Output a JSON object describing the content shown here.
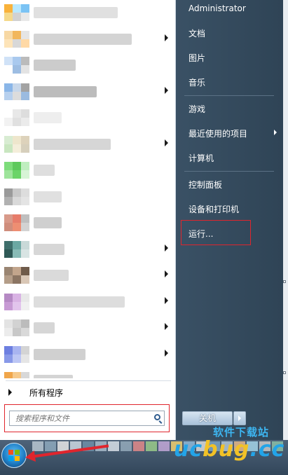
{
  "left_panel": {
    "rows": [
      {
        "icon_colors": [
          "#f9b23b",
          "#b8e8ff",
          "#7bc3f4",
          "#f5d98a",
          "#d1d1d1",
          "#e8e8e8"
        ],
        "label_color": "#e0e0e0",
        "label_width": 120,
        "has_submenu": false
      },
      {
        "icon_colors": [
          "#f7d8a4",
          "#f2b75c",
          "#e5e5e5",
          "#fde4b9",
          "#d8d8d8",
          "#ffd9a6"
        ],
        "label_color": "#d4d4d4",
        "label_width": 140,
        "has_submenu": true
      },
      {
        "icon_colors": [
          "#d0e2f7",
          "#a9c9ee",
          "#bbbbbb",
          "#ffffff",
          "#9dbde2",
          "#e3e3e3"
        ],
        "label_color": "#cccccc",
        "label_width": 60,
        "has_submenu": false
      },
      {
        "icon_colors": [
          "#8ab6e8",
          "#c7d7ea",
          "#a3a3a3",
          "#b7d0ee",
          "#dcdcdc",
          "#9bbbe0"
        ],
        "label_color": "#bcbcbc",
        "label_width": 90,
        "has_submenu": true
      },
      {
        "icon_colors": [
          "#ffffff",
          "#e8e8e8",
          "#dddddd",
          "#f2f2f2",
          "#e0e0e0",
          "#ebebeb"
        ],
        "label_color": "#eeeeee",
        "label_width": 40,
        "has_submenu": false
      },
      {
        "icon_colors": [
          "#d8ecd2",
          "#eee6cc",
          "#ddd2bb",
          "#c9e6c0",
          "#f4eeda",
          "#d6cfbc"
        ],
        "label_color": "#d6d6d6",
        "label_width": 110,
        "has_submenu": true
      },
      {
        "icon_colors": [
          "#7ddc7a",
          "#5ec95c",
          "#bfeebf",
          "#9ee49b",
          "#6bd468",
          "#d7f4d6"
        ],
        "label_color": "#dedede",
        "label_width": 30,
        "has_submenu": false
      },
      {
        "icon_colors": [
          "#9a9a9a",
          "#c8c8c8",
          "#dddddd",
          "#b1b1b1",
          "#d9d9d9",
          "#e4e4e4"
        ],
        "label_color": "#e0e0e0",
        "label_width": 40,
        "has_submenu": false
      },
      {
        "icon_colors": [
          "#d89a8a",
          "#e77c6a",
          "#bfbfbf",
          "#cf8d7c",
          "#ee8e72",
          "#d2d2d2"
        ],
        "label_color": "#cfcfcf",
        "label_width": 40,
        "has_submenu": false
      },
      {
        "icon_colors": [
          "#3f6f6c",
          "#6ba8a3",
          "#c9d9d8",
          "#2f5956",
          "#88bbb6",
          "#d8e4e3"
        ],
        "label_color": "#d7d7d7",
        "label_width": 44,
        "has_submenu": true
      },
      {
        "icon_colors": [
          "#9a8572",
          "#c2a58c",
          "#6f5b4a",
          "#b49d88",
          "#8b7563",
          "#d9c7b6"
        ],
        "label_color": "#dadada",
        "label_width": 50,
        "has_submenu": true
      },
      {
        "icon_colors": [
          "#b589c4",
          "#d9b3e4",
          "#e8e8e8",
          "#c79ad4",
          "#e2c4ec",
          "#f0f0f0"
        ],
        "label_color": "#dddddd",
        "label_width": 130,
        "has_submenu": true
      },
      {
        "icon_colors": [
          "#e3e3e3",
          "#d2d2d2",
          "#bcbcbc",
          "#ececec",
          "#c8c8c8",
          "#d9d9d9"
        ],
        "label_color": "#d6d6d6",
        "label_width": 30,
        "has_submenu": true
      },
      {
        "icon_colors": [
          "#6d7fe0",
          "#a8b4f0",
          "#d4d4d4",
          "#8899e8",
          "#bcc6f4",
          "#e5e5e5"
        ],
        "label_color": "#d0d0d0",
        "label_width": 74,
        "has_submenu": true
      },
      {
        "icon_colors": [
          "#f0a64a",
          "#f6c98a",
          "#d8d8d8",
          "#f3b667",
          "#fad9ae",
          "#e4e4e4"
        ],
        "label_color": "#d4d4d4",
        "label_width": 56,
        "has_submenu": false
      },
      {
        "icon_colors": [
          "#b7dced",
          "#d8eef7",
          "#e6e6e6",
          "#c6e5f2",
          "#e2f2f9",
          "#efefef"
        ],
        "label_color": "#e2e2e2",
        "label_width": 30,
        "has_submenu": false
      }
    ],
    "all_programs": "所有程序",
    "search_placeholder": "搜索程序和文件"
  },
  "right_panel": {
    "items": [
      {
        "key": "user",
        "label": "Administrator",
        "submenu": false
      },
      {
        "key": "documents",
        "label": "文档",
        "submenu": false
      },
      {
        "key": "pictures",
        "label": "图片",
        "submenu": false
      },
      {
        "key": "music",
        "label": "音乐",
        "submenu": false
      },
      {
        "key": "games",
        "label": "游戏",
        "submenu": false
      },
      {
        "key": "recent",
        "label": "最近使用的项目",
        "submenu": true
      },
      {
        "key": "computer",
        "label": "计算机",
        "submenu": false
      },
      {
        "key": "control-panel",
        "label": "控制面板",
        "submenu": false
      },
      {
        "key": "devices",
        "label": "设备和打印机",
        "submenu": false
      },
      {
        "key": "run",
        "label": "运行...",
        "submenu": false
      }
    ],
    "shutdown_label": "关机"
  },
  "taskbar": {
    "block_colors": [
      "#b9c7d2",
      "#8ea9bd",
      "#e7e7e7",
      "#cdd8e2",
      "#6f8fa8",
      "#a8bccb",
      "#d9e1e8",
      "#94aabb",
      "#e28a8a",
      "#9acb8a",
      "#c2a8d8",
      "#f0d070",
      "#8fb8d8",
      "#d9d9d9",
      "#7aa3c3",
      "#b0c4d4",
      "#e5b887",
      "#a4d4e8",
      "#c8c8c8",
      "#8bc0a8"
    ]
  },
  "watermark": {
    "sub": "软件下载站",
    "main_prefix": "uc",
    "main_highlight": "bug",
    "main_suffix": ".cc"
  },
  "colors": {
    "highlight_red": "#e0252d",
    "panel_dark": "#3a5165"
  }
}
